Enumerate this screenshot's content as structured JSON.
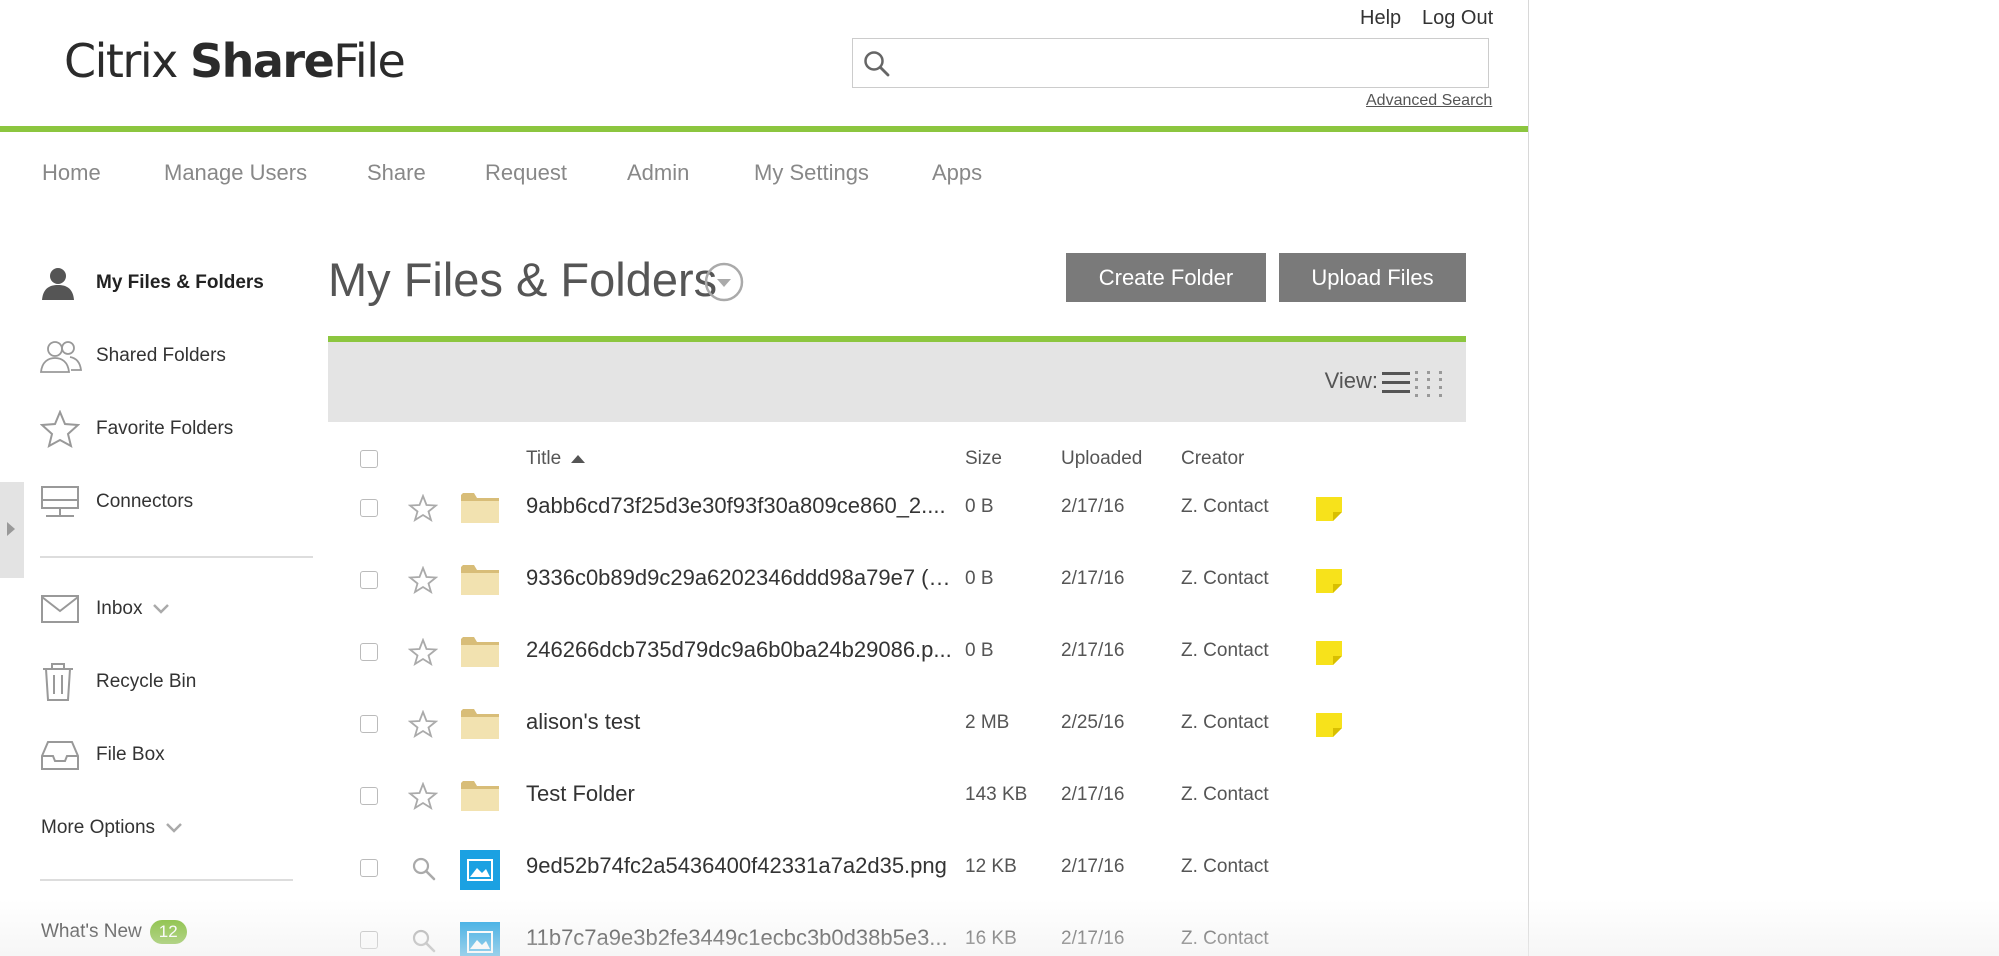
{
  "brand": {
    "logo_part1": "Citrix ",
    "logo_part2": "Share",
    "logo_part3": "File",
    "accent": "#8cc63f"
  },
  "header": {
    "help": "Help",
    "logout": "Log Out",
    "search_placeholder": "",
    "advanced_search": "Advanced Search"
  },
  "nav": [
    "Home",
    "Manage Users",
    "Share",
    "Request",
    "Admin",
    "My Settings",
    "Apps"
  ],
  "sidebar": {
    "items": [
      {
        "label": "My Files & Folders",
        "icon": "user-icon"
      },
      {
        "label": "Shared Folders",
        "icon": "users-icon"
      },
      {
        "label": "Favorite Folders",
        "icon": "star-icon"
      },
      {
        "label": "Connectors",
        "icon": "connector-icon"
      },
      {
        "label": "Inbox",
        "icon": "mail-icon"
      },
      {
        "label": "Recycle Bin",
        "icon": "trash-icon"
      },
      {
        "label": "File Box",
        "icon": "inbox-tray-icon"
      }
    ],
    "more_options": "More Options",
    "whats_new": "What's New",
    "whats_new_count": "12"
  },
  "main": {
    "title": "My Files & Folders",
    "create_folder": "Create Folder",
    "upload_files": "Upload Files",
    "view_label": "View:",
    "columns": {
      "title": "Title",
      "size": "Size",
      "uploaded": "Uploaded",
      "creator": "Creator"
    },
    "rows": [
      {
        "name": "9abb6cd73f25d3e30f93f30a809ce860_2....",
        "size": "0 B",
        "uploaded": "2/17/16",
        "creator": "Z. Contact",
        "type": "folder",
        "note": true
      },
      {
        "name": "9336c0b89d9c29a6202346ddd98a79e7 (1...",
        "size": "0 B",
        "uploaded": "2/17/16",
        "creator": "Z. Contact",
        "type": "folder",
        "note": true
      },
      {
        "name": "246266dcb735d79dc9a6b0ba24b29086.p...",
        "size": "0 B",
        "uploaded": "2/17/16",
        "creator": "Z. Contact",
        "type": "folder",
        "note": true
      },
      {
        "name": "alison's test",
        "size": "2 MB",
        "uploaded": "2/25/16",
        "creator": "Z. Contact",
        "type": "folder",
        "note": true
      },
      {
        "name": "Test Folder",
        "size": "143 KB",
        "uploaded": "2/17/16",
        "creator": "Z. Contact",
        "type": "folder",
        "note": false
      },
      {
        "name": "9ed52b74fc2a5436400f42331a7a2d35.png",
        "size": "12 KB",
        "uploaded": "2/17/16",
        "creator": "Z. Contact",
        "type": "image",
        "note": false
      },
      {
        "name": "11b7c7a9e3b2fe3449c1ecbc3b0d38b5e3...",
        "size": "16 KB",
        "uploaded": "2/17/16",
        "creator": "Z. Contact",
        "type": "image",
        "note": false
      }
    ]
  }
}
